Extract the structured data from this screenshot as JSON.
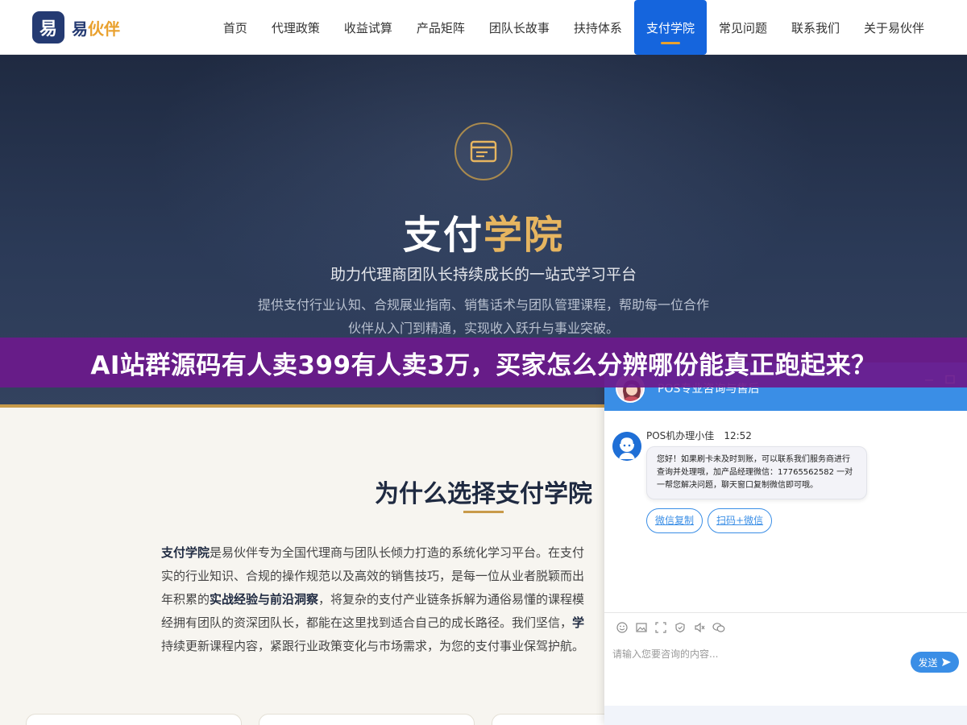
{
  "header": {
    "logo_mark": "易",
    "logo_text_a": "易",
    "logo_text_b": "伙伴",
    "nav": [
      {
        "label": "首页"
      },
      {
        "label": "代理政策"
      },
      {
        "label": "收益试算"
      },
      {
        "label": "产品矩阵"
      },
      {
        "label": "团队长故事"
      },
      {
        "label": "扶持体系"
      },
      {
        "label": "支付学院",
        "active": true
      },
      {
        "label": "常见问题"
      },
      {
        "label": "联系我们"
      },
      {
        "label": "关于易伙伴"
      }
    ]
  },
  "hero": {
    "icon": "browser-window-icon",
    "title_a": "支付",
    "title_b": "学院",
    "subtitle": "助力代理商团队长持续成长的一站式学习平台",
    "desc_line1": "提供支付行业认知、合规展业指南、销售话术与团队管理课程，帮助每一位合作",
    "desc_line2": "伙伴从入门到精通，实现收入跃升与事业突破。"
  },
  "banner": {
    "text": "AI站群源码有人卖399有人卖3万，买家怎么分辨哪份能真正跑起来？"
  },
  "content": {
    "section_title": "为什么选择支付学院",
    "intro": {
      "l1_bold": "支付学院",
      "l1_rest": "是易伙伴专为全国代理商与团队长倾力打造的系统化学习平台。在支付",
      "l2": "实的行业知识、合规的操作规范以及高效的销售技巧，是每一位从业者脱颖而出",
      "l3_a": "年积累的",
      "l3_bold": "实战经验与前沿洞察",
      "l3_b": "，将复杂的支付产业链条拆解为通俗易懂的课程模",
      "l4_a": "经拥有团队的资深团队长，都能在这里找到适合自己的成长路径。我们坚信，",
      "l4_bold": "学",
      "l5": "持续更新课程内容，紧跟行业政策变化与市场需求，为您的支付事业保驾护航。"
    }
  },
  "chat": {
    "title": "POS专业咨询与售后",
    "agent_name": "POS机办理小佳",
    "agent_time": "12:52",
    "message": "您好！如果刷卡未及时到账，可以联系我们服务商进行查询并处理哦，加产品经理微信：17765562582 一对一帮您解决问题，聊天窗口复制微信即可哦。",
    "quick_buttons": [
      "微信复制",
      "扫码+微信"
    ],
    "input_placeholder": "请输入您要咨询的内容...",
    "send_label": "发送",
    "toolbar_icons": [
      "emoji-icon",
      "image-icon",
      "screenshot-icon",
      "evaluate-icon",
      "voice-icon",
      "wechat-icon"
    ],
    "colors": {
      "primary": "#3a8ee6"
    }
  },
  "colors": {
    "brand_navy": "#243a72",
    "brand_gold": "#e9a12e",
    "nav_active": "#1565dd",
    "banner_purple": "#6c1a8c"
  }
}
